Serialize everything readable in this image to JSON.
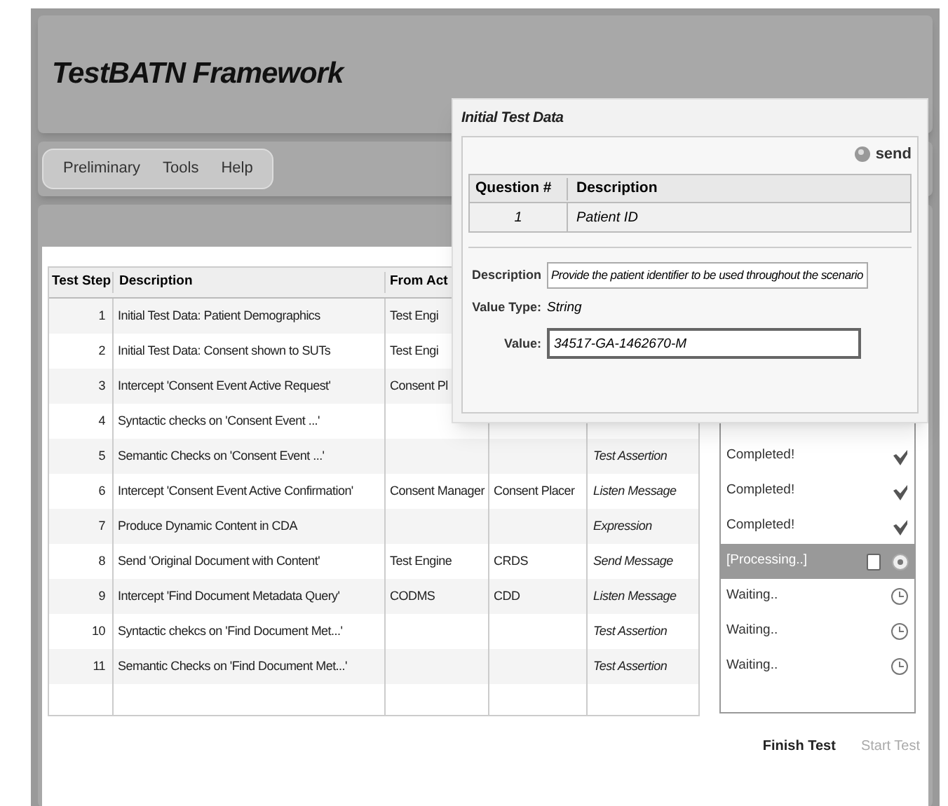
{
  "header": {
    "title": "TestBATN Framework"
  },
  "menu": [
    "Preliminary",
    "Tools",
    "Help"
  ],
  "table": {
    "columns": [
      "Test Step",
      "Description",
      "From Act"
    ],
    "rows": [
      {
        "step": "1",
        "description": "Initial Test Data: Patient Demographics",
        "from_actor": "Test Engi"
      },
      {
        "step": "2",
        "description": "Initial Test Data: Consent shown to SUTs",
        "from_actor": "Test Engi"
      },
      {
        "step": "3",
        "description": "Intercept 'Consent Event Active Request'",
        "from_actor": "Consent Pl"
      },
      {
        "step": "4",
        "description": "Syntactic checks on 'Consent Event ...'",
        "from_actor": ""
      },
      {
        "step": "5",
        "description": "Semantic Checks on 'Consent Event ...'",
        "from_actor": "",
        "to_actor": "",
        "type": "Test Assertion",
        "status": {
          "text": "Completed!",
          "kind": "completed"
        }
      },
      {
        "step": "6",
        "description": "Intercept 'Consent Event Active Confirmation'",
        "from_actor": "Consent Manager",
        "to_actor": "Consent Placer",
        "type": "Listen Message",
        "status": {
          "text": "Completed!",
          "kind": "completed"
        }
      },
      {
        "step": "7",
        "description": "Produce Dynamic Content in CDA",
        "from_actor": "",
        "to_actor": "",
        "type": "Expression",
        "status": {
          "text": "Completed!",
          "kind": "completed"
        }
      },
      {
        "step": "8",
        "description": "Send 'Original Document with Content'",
        "from_actor": "Test Engine",
        "to_actor": "CRDS",
        "type": "Send Message",
        "status": {
          "text": "[Processing..]",
          "kind": "processing"
        }
      },
      {
        "step": "9",
        "description": "Intercept 'Find Document Metadata Query'",
        "from_actor": "CODMS",
        "to_actor": "CDD",
        "type": "Listen Message",
        "status": {
          "text": "Waiting..",
          "kind": "waiting"
        }
      },
      {
        "step": "10",
        "description": "Syntactic chekcs on 'Find Document Met...'",
        "from_actor": "",
        "to_actor": "",
        "type": "Test Assertion",
        "status": {
          "text": "Waiting..",
          "kind": "waiting"
        }
      },
      {
        "step": "11",
        "description": "Semantic Checks on 'Find Document Met...'",
        "from_actor": "",
        "to_actor": "",
        "type": "Test Assertion",
        "status": {
          "text": "Waiting..",
          "kind": "waiting"
        }
      }
    ]
  },
  "buttons": [
    {
      "label": "Finish Test",
      "disabled": false
    },
    {
      "label": "Start Test",
      "disabled": true
    }
  ],
  "dialog": {
    "title": "Initial Test Data",
    "send_label": "send",
    "questions": {
      "columns": [
        "Question #",
        "Description"
      ],
      "rows": [
        {
          "number": "1",
          "description": "Patient ID"
        }
      ]
    },
    "description_label": "Description",
    "description": "Provide the patient identifier to be used throughout the scenario",
    "value_type_label": "Value Type:",
    "value_type": "String",
    "value_label": "Value:",
    "value": "34517-GA-1462670-M"
  }
}
